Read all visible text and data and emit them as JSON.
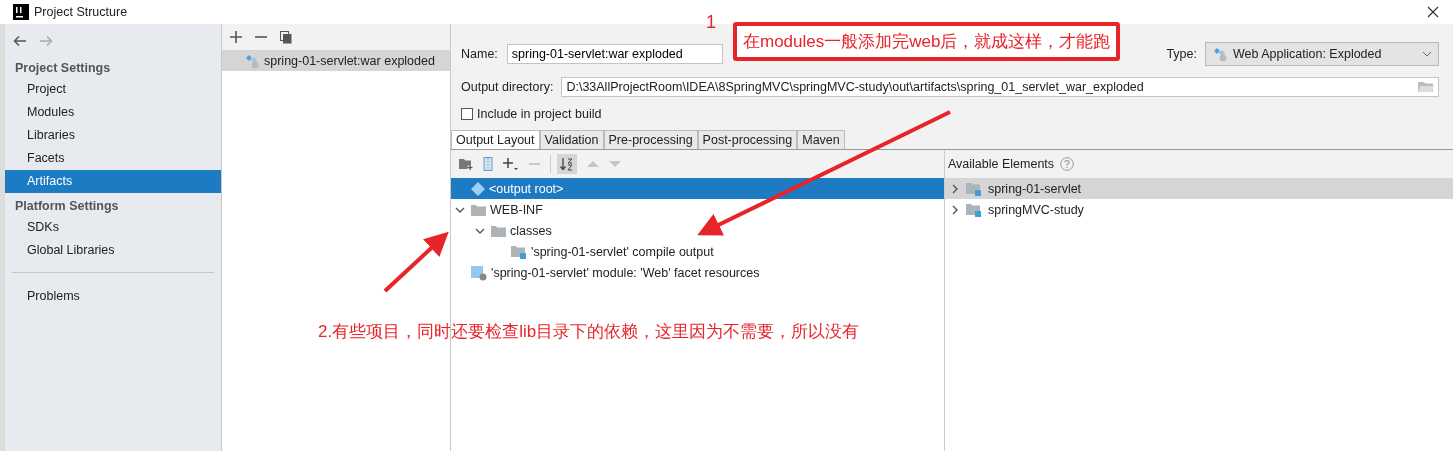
{
  "window": {
    "title": "Project Structure"
  },
  "sidebar": {
    "sections": [
      {
        "title": "Project Settings",
        "items": [
          {
            "label": "Project",
            "selected": false
          },
          {
            "label": "Modules",
            "selected": false
          },
          {
            "label": "Libraries",
            "selected": false
          },
          {
            "label": "Facets",
            "selected": false
          },
          {
            "label": "Artifacts",
            "selected": true
          }
        ]
      },
      {
        "title": "Platform Settings",
        "items": [
          {
            "label": "SDKs",
            "selected": false
          },
          {
            "label": "Global Libraries",
            "selected": false
          }
        ]
      }
    ],
    "bottom_items": [
      {
        "label": "Problems",
        "selected": false
      }
    ]
  },
  "artifacts": [
    {
      "label": "spring-01-servlet:war exploded",
      "selected": true
    }
  ],
  "form": {
    "name_label": "Name:",
    "name_value": "spring-01-servlet:war exploded",
    "type_label": "Type:",
    "type_value": "Web Application: Exploded",
    "output_label": "Output directory:",
    "output_value": "D:\\33AllProjectRoom\\IDEA\\8SpringMVC\\springMVC-study\\out\\artifacts\\spring_01_servlet_war_exploded",
    "include_label": "Include in project build",
    "include_checked": false
  },
  "tabs": [
    {
      "label": "Output Layout",
      "selected": true
    },
    {
      "label": "Validation",
      "selected": false
    },
    {
      "label": "Pre-processing",
      "selected": false
    },
    {
      "label": "Post-processing",
      "selected": false
    },
    {
      "label": "Maven",
      "selected": false
    }
  ],
  "layout_tree": [
    {
      "label": "<output root>",
      "kind": "root",
      "selected": true,
      "children": [
        {
          "label": "WEB-INF",
          "kind": "folder",
          "selected": false,
          "expanded": true,
          "children": [
            {
              "label": "classes",
              "kind": "folder",
              "selected": false,
              "expanded": true,
              "children": [
                {
                  "label": "'spring-01-servlet' compile output",
                  "kind": "output",
                  "selected": false
                }
              ]
            }
          ]
        },
        {
          "label": "'spring-01-servlet' module: 'Web' facet resources",
          "kind": "facet",
          "selected": false
        }
      ]
    }
  ],
  "available": {
    "title": "Available Elements",
    "items": [
      {
        "label": "spring-01-servlet",
        "selected": true,
        "expanded": false
      },
      {
        "label": "springMVC-study",
        "selected": false,
        "expanded": false
      }
    ]
  },
  "annotations": [
    {
      "label": "1",
      "kind": "number"
    },
    {
      "label": "在modules一般添加完web后，就成这样，才能跑",
      "kind": "callout"
    },
    {
      "label": "2.有些项目，同时还要检查lib目录下的依赖，这里因为不需要，所以没有",
      "kind": "note"
    }
  ]
}
